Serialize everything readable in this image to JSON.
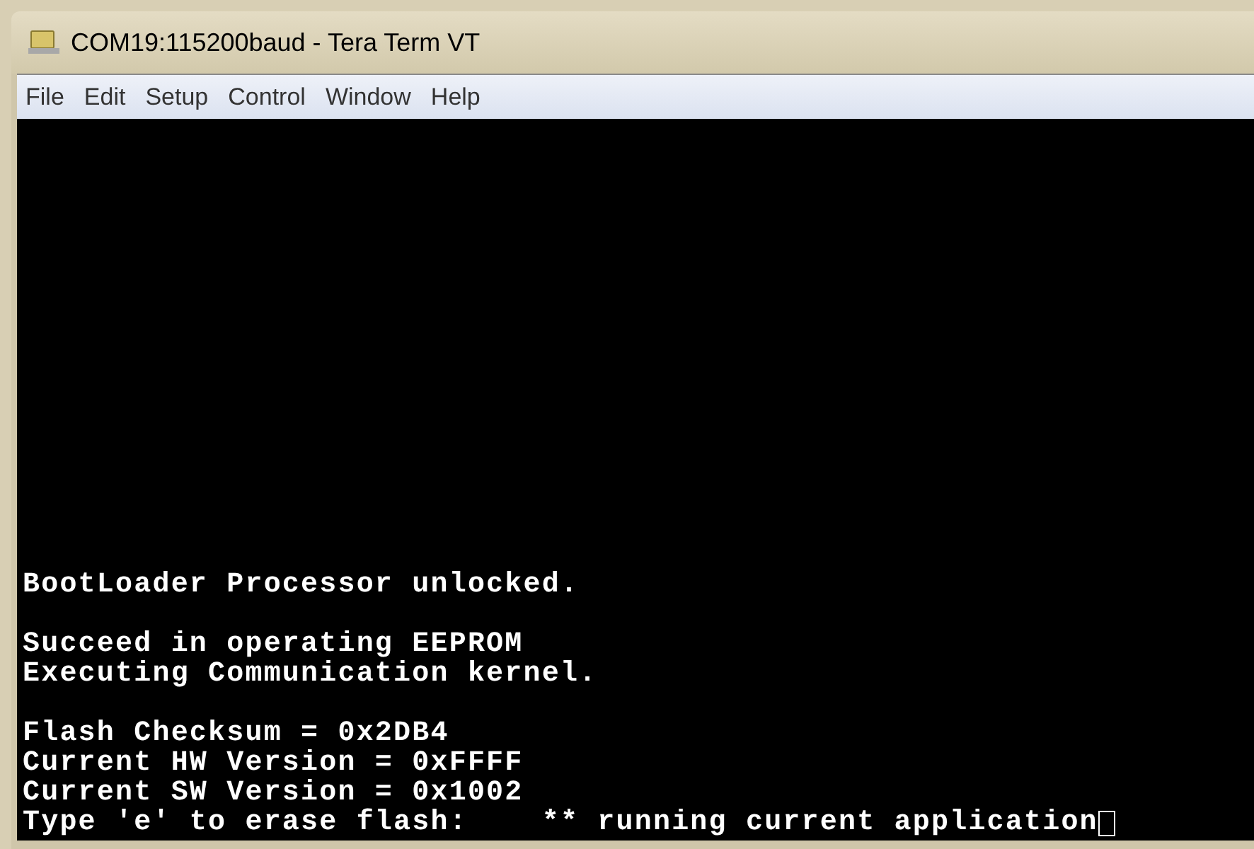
{
  "window": {
    "title": "COM19:115200baud - Tera Term VT"
  },
  "menu": [
    "File",
    "Edit",
    "Setup",
    "Control",
    "Window",
    "Help"
  ],
  "terminal": {
    "blocks": [
      [
        "BootLoader Processor unlocked."
      ],
      [
        "Succeed in operating EEPROM",
        "Executing Communication kernel."
      ],
      [
        "Flash Checksum = 0x2DB4",
        "Current HW Version = 0xFFFF",
        "Current SW Version = 0x1002",
        "Type 'e' to erase flash:    ** running current application"
      ]
    ],
    "cursor": true
  }
}
